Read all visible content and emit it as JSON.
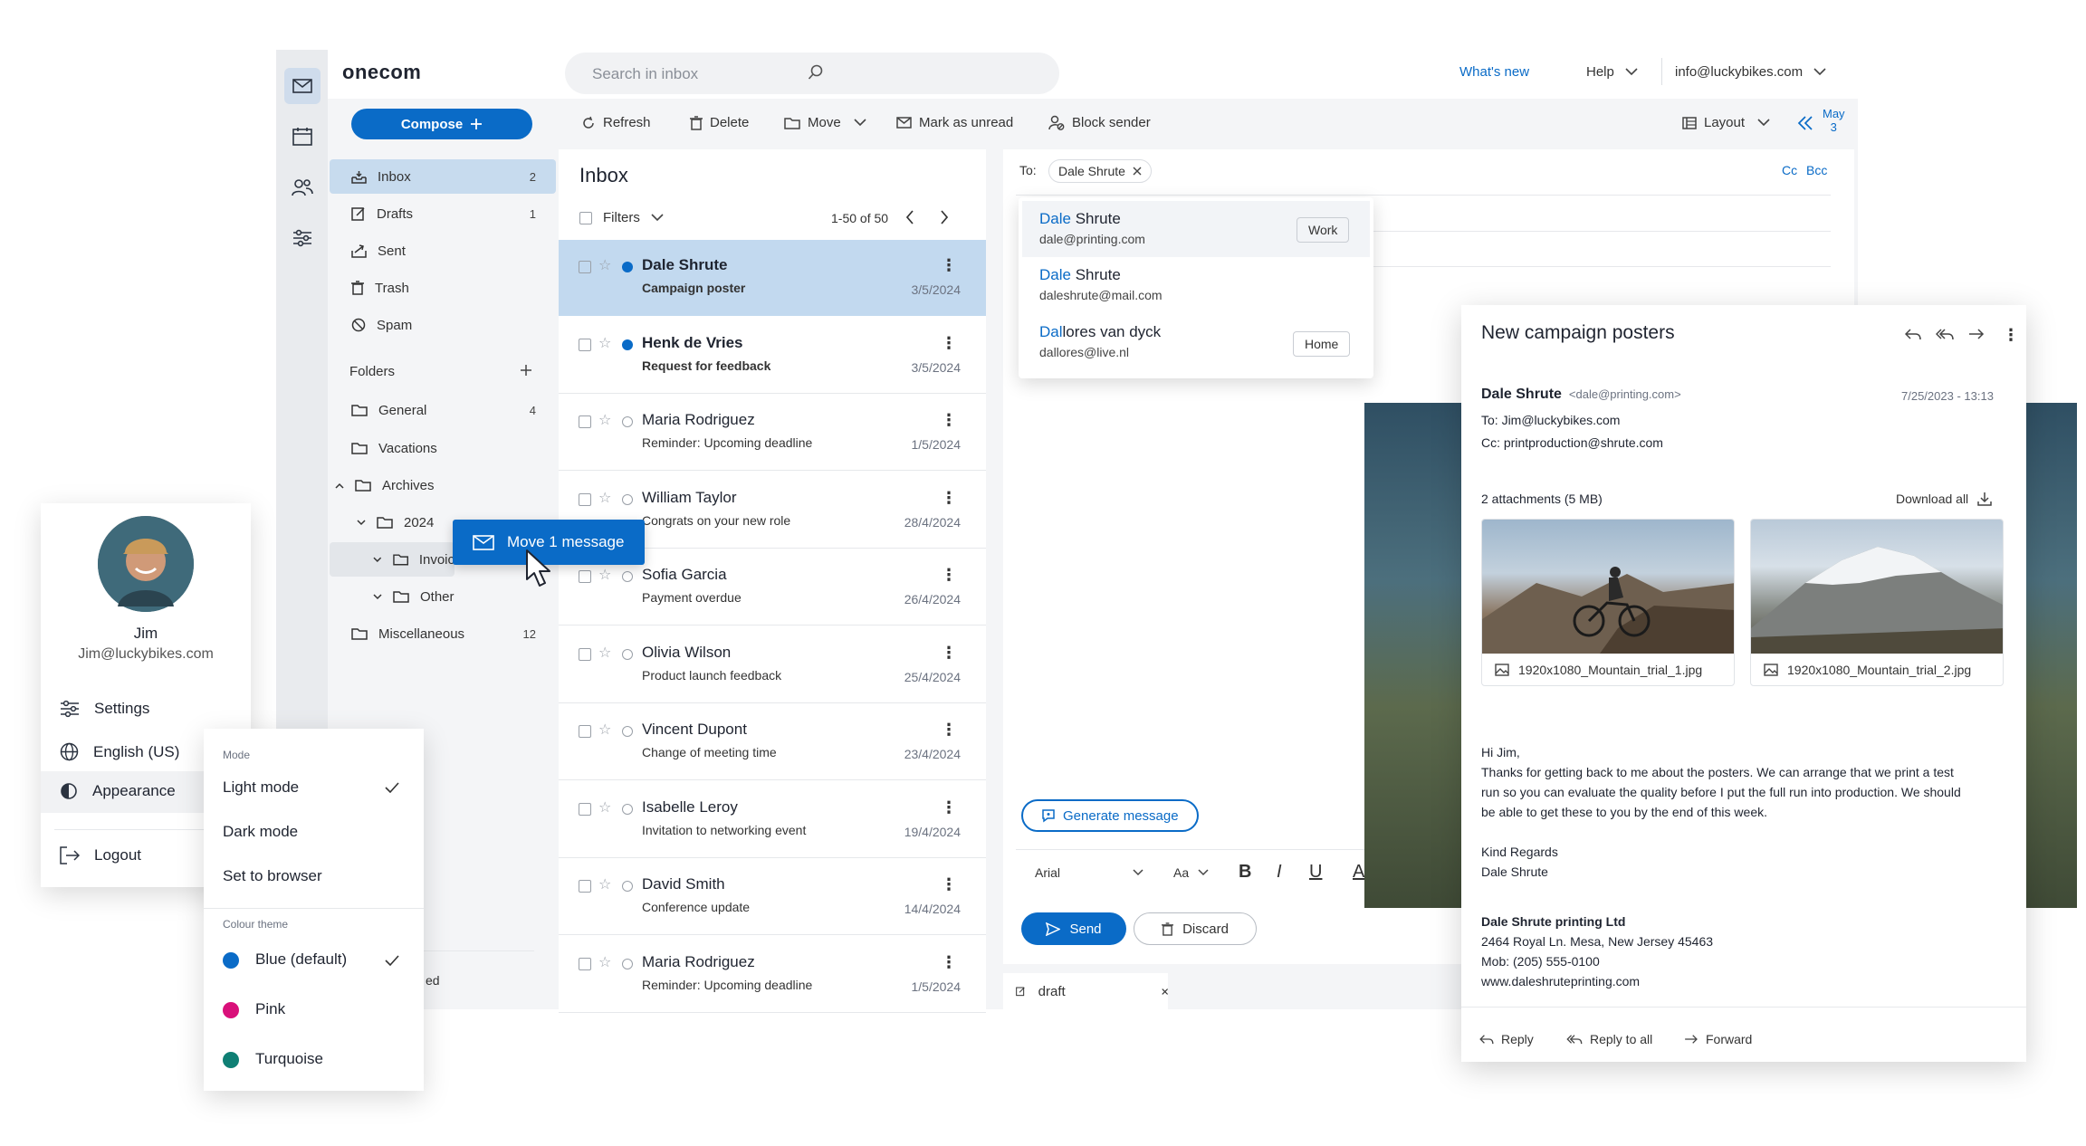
{
  "brand": {
    "logo_main": "one",
    "logo_dot": ".",
    "logo_tld": "com",
    "accent": "#0a6bc7"
  },
  "topbar": {
    "search_placeholder": "Search in inbox",
    "whats_new": "What's new",
    "help": "Help",
    "account": "info@luckybikes.com"
  },
  "toolbar": {
    "compose": "Compose",
    "refresh": "Refresh",
    "delete": "Delete",
    "move": "Move",
    "mark_unread": "Mark as unread",
    "block_sender": "Block sender",
    "layout": "Layout",
    "date_month": "May",
    "date_day": "3"
  },
  "sidebar": {
    "items": [
      {
        "label": "Inbox",
        "count": "2"
      },
      {
        "label": "Drafts",
        "count": "1"
      },
      {
        "label": "Sent",
        "count": ""
      },
      {
        "label": "Trash",
        "count": ""
      },
      {
        "label": "Spam",
        "count": ""
      }
    ],
    "folders_title": "Folders",
    "folders": [
      {
        "label": "General",
        "count": "4"
      },
      {
        "label": "Vacations",
        "count": ""
      },
      {
        "label": "Archives",
        "count": ""
      },
      {
        "label": "2024",
        "count": ""
      },
      {
        "label": "Invoic",
        "count": ""
      },
      {
        "label": "Other",
        "count": ""
      },
      {
        "label": "Miscellaneous",
        "count": "12"
      }
    ],
    "partial_text": "ed"
  },
  "list": {
    "title": "Inbox",
    "filters": "Filters",
    "range": "1-50 of 50",
    "messages": [
      {
        "from": "Dale Shrute",
        "subject": "Campaign poster",
        "date": "3/5/2024"
      },
      {
        "from": "Henk de Vries",
        "subject": "Request for feedback",
        "date": "3/5/2024"
      },
      {
        "from": "Maria Rodriguez",
        "subject": "Reminder: Upcoming deadline",
        "date": "1/5/2024"
      },
      {
        "from": "William Taylor",
        "subject": "Congrats on your new role",
        "date": "28/4/2024"
      },
      {
        "from": "Sofia Garcia",
        "subject": "Payment overdue",
        "date": "26/4/2024"
      },
      {
        "from": "Olivia Wilson",
        "subject": "Product launch feedback",
        "date": "25/4/2024"
      },
      {
        "from": "Vincent Dupont",
        "subject": "Change of meeting time",
        "date": "23/4/2024"
      },
      {
        "from": "Isabelle Leroy",
        "subject": "Invitation to networking event",
        "date": "19/4/2024"
      },
      {
        "from": "David Smith",
        "subject": "Conference update",
        "date": "14/4/2024"
      },
      {
        "from": "Maria Rodriguez",
        "subject": "Reminder: Upcoming deadline",
        "date": "1/5/2024"
      }
    ]
  },
  "drag": {
    "label": "Move 1 message"
  },
  "compose": {
    "to_label": "To:",
    "recipient": "Dale Shrute",
    "cc": "Cc",
    "bcc": "Bcc",
    "generate": "Generate message",
    "font": "Arial",
    "size": "Aa",
    "bold": "B",
    "italic": "I",
    "underline": "U",
    "partial": "A",
    "send": "Send",
    "discard": "Discard",
    "draft": "draft"
  },
  "autocomplete": [
    {
      "match": "Dale",
      "rest": " Shrute",
      "email": "dale@printing.com",
      "tag": "Work"
    },
    {
      "match": "Dale",
      "rest": " Shrute",
      "email": "daleshrute@mail.com",
      "tag": ""
    },
    {
      "match": "Dal",
      "rest": "lores van dyck",
      "email": "dallores@live.nl",
      "tag": "Home"
    }
  ],
  "reader": {
    "subject": "New campaign posters",
    "sender": "Dale Shrute",
    "sender_email": "<dale@printing.com>",
    "datetime": "7/25/2023 - 13:13",
    "to": "To: Jim@luckybikes.com",
    "cc": "Cc: printproduction@shrute.com",
    "attachments_label": "2 attachments (5 MB)",
    "download_all": "Download all",
    "attachments": [
      "1920x1080_Mountain_trial_1.jpg",
      "1920x1080_Mountain_trial_2.jpg"
    ],
    "greeting": "Hi Jim,",
    "body": [
      "Thanks for getting back to me about the posters. We can arrange that we print a test",
      "run so you can evaluate the quality before I put the full run into production. We should",
      "be able to get these to you by the end of this week."
    ],
    "regards": "Kind Regards",
    "signoff": "Dale Shrute",
    "sig_company": "Dale Shrute printing Ltd",
    "sig_address": "2464 Royal Ln. Mesa, New Jersey 45463",
    "sig_mob": "Mob: (205) 555-0100",
    "sig_web": "www.daleshruteprinting.com",
    "reply": "Reply",
    "reply_all": "Reply to all",
    "forward": "Forward"
  },
  "profile": {
    "name": "Jim",
    "email": "Jim@luckybikes.com",
    "settings": "Settings",
    "language": "English (US)",
    "appearance": "Appearance",
    "logout": "Logout"
  },
  "appearance": {
    "mode_label": "Mode",
    "modes": [
      "Light mode",
      "Dark mode",
      "Set to browser"
    ],
    "theme_label": "Colour theme",
    "themes": [
      {
        "label": "Blue (default)",
        "color": "#0a6bc7"
      },
      {
        "label": "Pink",
        "color": "#d9107a"
      },
      {
        "label": "Turquoise",
        "color": "#0f7f74"
      }
    ]
  }
}
